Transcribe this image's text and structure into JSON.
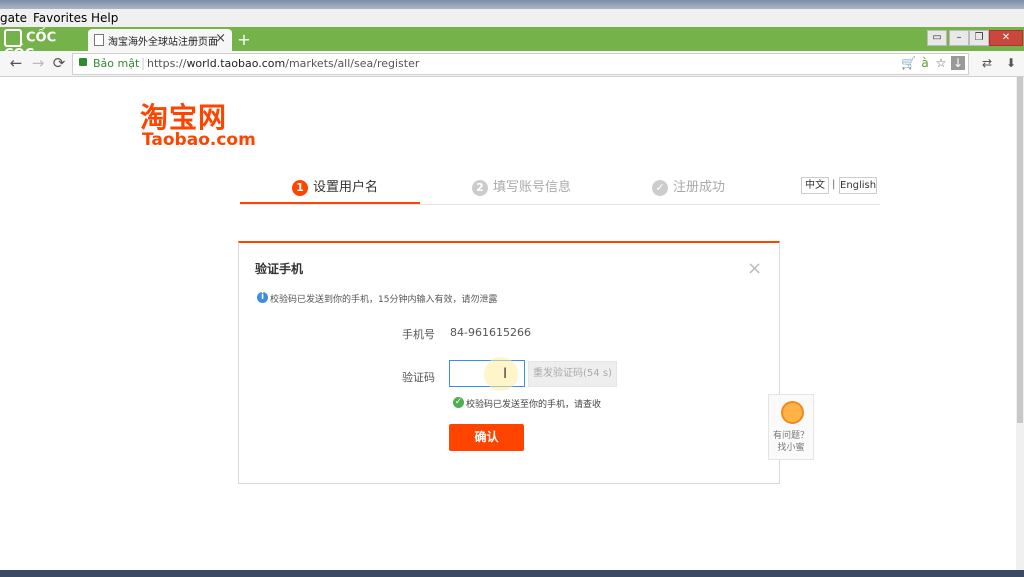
{
  "menubar": {
    "items": [
      "gate",
      "Favorites",
      "Help"
    ]
  },
  "browser": {
    "brand": "CỐC CỐC",
    "tab_title": "淘宝海外全球站注册页面",
    "tab_close": "×",
    "new_tab": "+",
    "window_buttons": [
      "▭",
      "–",
      "❐",
      "✕"
    ],
    "nav": {
      "back": "←",
      "forward": "→",
      "reload": "⟳"
    },
    "address": {
      "security_label": "Bảo mật",
      "scheme": "https://",
      "host": "world.taobao.com",
      "path": "/markets/all/sea/register"
    },
    "toolbar_icons": [
      "cart-icon",
      "translate-icon",
      "star-icon",
      "download-icon",
      "extension-icon",
      "downloads-icon"
    ],
    "toolbar_glyphs": [
      "🛒",
      "à",
      "☆",
      "↓",
      "⇄",
      "⬇"
    ]
  },
  "page": {
    "logo_cn": "淘宝网",
    "logo_en": "Taobao.com",
    "steps": [
      {
        "num": "1",
        "label": "设置用户名",
        "active": true
      },
      {
        "num": "2",
        "label": "填写账号信息",
        "active": false
      },
      {
        "num": "✓",
        "label": "注册成功",
        "active": false
      }
    ],
    "lang": {
      "zh": "中文",
      "sep": "|",
      "en": "English"
    },
    "dialog": {
      "title": "验证手机",
      "close": "×",
      "info_icon": "i",
      "info_text": "校验码已发送到你的手机，15分钟内输入有效，请勿泄露",
      "phone_label": "手机号",
      "phone_value": "84-961615266",
      "code_label": "验证码",
      "code_value": "",
      "cursor_glyph": "I",
      "resend_label": "重发验证码(54 s)",
      "success_icon": "✓",
      "success_text": "校验码已发送至你的手机，请查收",
      "confirm_label": "确认"
    },
    "help": {
      "line1": "有问题？",
      "line2": "找小蜜"
    }
  },
  "colors": {
    "accent": "#ff4400",
    "browser_green": "#75b24a",
    "info_blue": "#3a8ee6",
    "success_green": "#4caf50"
  }
}
